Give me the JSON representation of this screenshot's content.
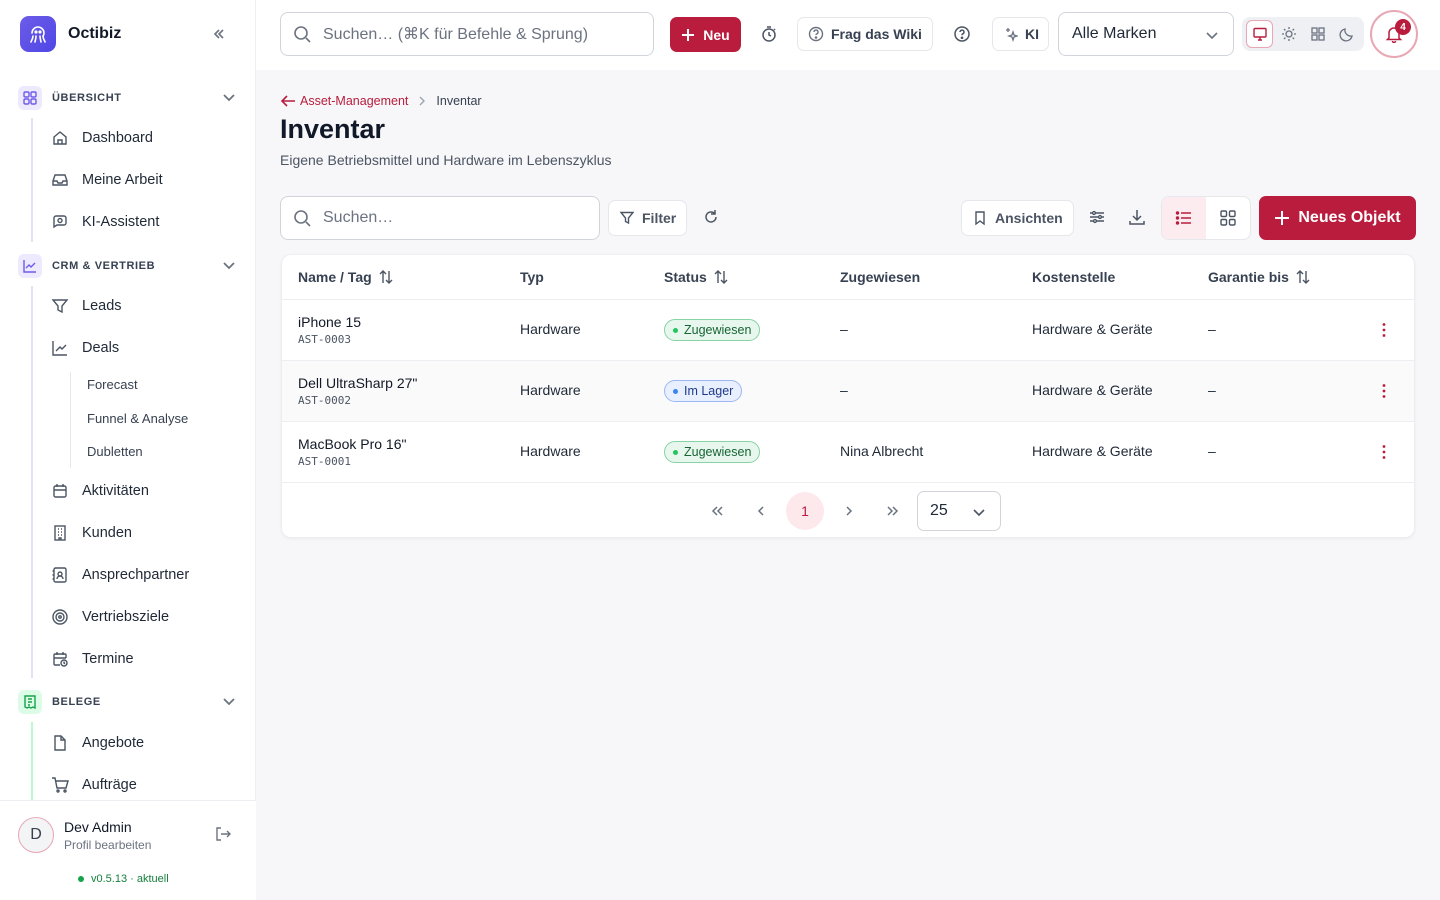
{
  "app": {
    "name": "Octibiz",
    "colors": {
      "accent": "#b91c3c",
      "brand": "#4f46e5"
    }
  },
  "sidebar": {
    "sections": [
      {
        "label": "ÜBERSICHT",
        "items": [
          "Dashboard",
          "Meine Arbeit",
          "KI-Assistent"
        ]
      },
      {
        "label": "CRM & VERTRIEB",
        "items": [
          "Leads",
          "Deals",
          "Aktivitäten",
          "Kunden",
          "Ansprechpartner",
          "Vertriebsziele",
          "Termine"
        ],
        "sub_items": [
          "Forecast",
          "Funnel & Analyse",
          "Dubletten"
        ]
      },
      {
        "label": "BELEGE",
        "items": [
          "Angebote",
          "Aufträge"
        ]
      }
    ],
    "user": {
      "initial": "D",
      "name": "Dev Admin",
      "sub": "Profil bearbeiten"
    },
    "version": "v0.5.13 · aktuell"
  },
  "topbar": {
    "search_placeholder": "Suchen… (⌘K für Befehle & Sprung)",
    "new_label": "Neu",
    "wiki_label": "Frag das Wiki",
    "ai_label": "KI",
    "brand_select": "Alle Marken",
    "notifications": "4"
  },
  "breadcrumb": {
    "back": "Asset-Management",
    "current": "Inventar"
  },
  "page": {
    "title": "Inventar",
    "subtitle": "Eigene Betriebsmittel und Hardware im Lebenszyklus"
  },
  "toolbar": {
    "search_placeholder": "Suchen…",
    "filter_label": "Filter",
    "views_label": "Ansichten",
    "new_object_label": "Neues Objekt"
  },
  "table": {
    "columns": [
      "Name / Tag",
      "Typ",
      "Status",
      "Zugewiesen",
      "Kostenstelle",
      "Garantie bis"
    ],
    "rows": [
      {
        "name": "iPhone 15",
        "tag": "AST-0003",
        "type": "Hardware",
        "status": "Zugewiesen",
        "assigned": "–",
        "cost_center": "Hardware & Geräte",
        "warranty": "–"
      },
      {
        "name": "Dell UltraSharp 27\"",
        "tag": "AST-0002",
        "type": "Hardware",
        "status": "Im Lager",
        "assigned": "–",
        "cost_center": "Hardware & Geräte",
        "warranty": "–"
      },
      {
        "name": "MacBook Pro 16\"",
        "tag": "AST-0001",
        "type": "Hardware",
        "status": "Zugewiesen",
        "assigned": "Nina Albrecht",
        "cost_center": "Hardware & Geräte",
        "warranty": "–"
      }
    ]
  },
  "pagination": {
    "current": "1",
    "page_size": "25"
  }
}
